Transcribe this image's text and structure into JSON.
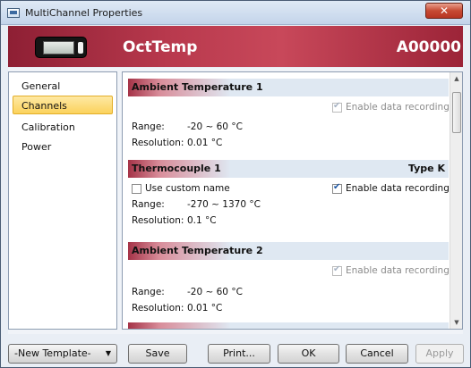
{
  "window": {
    "title": "MultiChannel Properties",
    "close_label": "✕"
  },
  "header": {
    "device_name": "OctTemp",
    "serial": "A00000"
  },
  "sidebar": {
    "items": [
      {
        "label": "General"
      },
      {
        "label": "Channels",
        "selected": true
      },
      {
        "label": "Calibration"
      },
      {
        "label": "Power"
      }
    ]
  },
  "channels": [
    {
      "title": "Ambient Temperature 1",
      "type": "",
      "enable_label": "Enable data recording",
      "enable_checked": true,
      "enable_disabled": true,
      "range_label": "Range:",
      "range_value": "-20 ~ 60 °C",
      "resolution_label": "Resolution:",
      "resolution_value": "0.01 °C"
    },
    {
      "title": "Thermocouple 1",
      "type": "Type K",
      "custom_name_label": "Use custom name",
      "custom_name_checked": false,
      "enable_label": "Enable data recording",
      "enable_checked": true,
      "enable_disabled": false,
      "range_label": "Range:",
      "range_value": "-270 ~ 1370 °C",
      "resolution_label": "Resolution:",
      "resolution_value": "0.1 °C"
    },
    {
      "title": "Ambient Temperature 2",
      "type": "",
      "enable_label": "Enable data recording",
      "enable_checked": true,
      "enable_disabled": true,
      "range_label": "Range:",
      "range_value": "-20 ~ 60 °C",
      "resolution_label": "Resolution:",
      "resolution_value": "0.01 °C"
    }
  ],
  "footer": {
    "template_select": "-New Template-",
    "save": "Save",
    "print": "Print...",
    "ok": "OK",
    "cancel": "Cancel",
    "apply": "Apply"
  },
  "colors": {
    "accent": "#b8394d",
    "selection": "#fbd25c"
  }
}
